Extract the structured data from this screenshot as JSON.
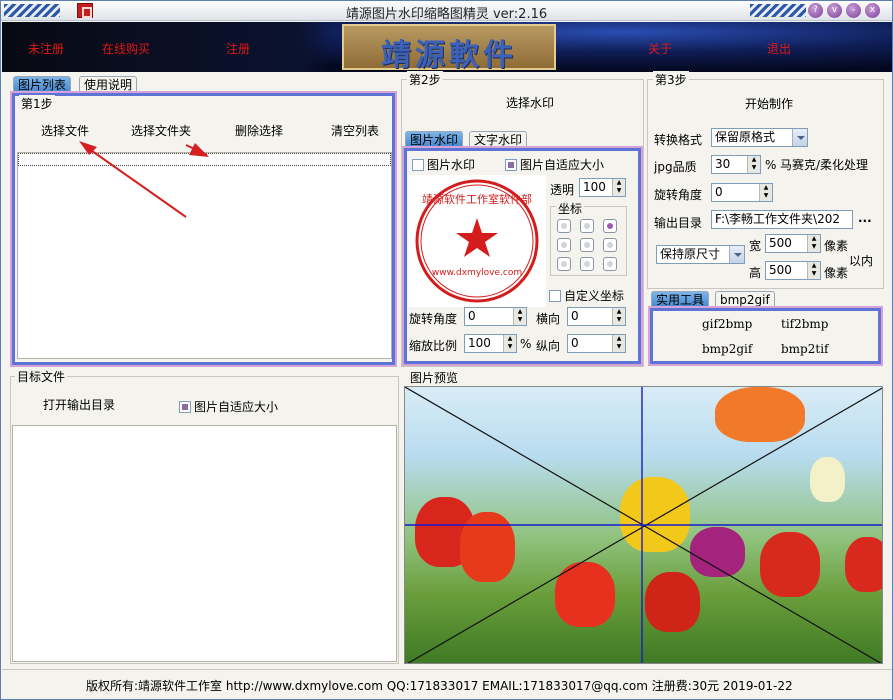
{
  "window": {
    "title": "靖源图片水印缩略图精灵 ver:2.16",
    "controls": [
      "?",
      "v",
      "-",
      "x"
    ]
  },
  "header": {
    "nav": [
      "未注册",
      "在线购买",
      "注册",
      "关于",
      "退出"
    ],
    "logo_text": "靖源軟件"
  },
  "left_tabs": [
    "图片列表",
    "使用说明"
  ],
  "step1": {
    "label": "第1步",
    "buttons": [
      "选择文件",
      "选择文件夹",
      "删除选择",
      "清空列表"
    ]
  },
  "target": {
    "label": "目标文件",
    "open_output": "打开输出目录",
    "fit_checkbox": "图片自适应大小",
    "fit_checked": true
  },
  "step2": {
    "label": "第2步",
    "select_watermark": "选择水印",
    "tabs": [
      "图片水印",
      "文字水印"
    ],
    "image_watermark_checkbox": "图片水印",
    "image_watermark_checked": false,
    "fit_checkbox": "图片自适应大小",
    "fit_checked": true,
    "transparency_label": "透明",
    "transparency_value": "100",
    "coords_label": "坐标",
    "custom_coords": "自定义坐标",
    "rotate_label": "旋转角度",
    "rotate_value": "0",
    "horizontal_label": "横向",
    "horizontal_value": "0",
    "scale_label": "缩放比例",
    "scale_value": "100",
    "percent": "%",
    "vertical_label": "纵向",
    "vertical_value": "0",
    "seal_text": "靖源软件工作室软件部",
    "seal_url": "www.dxmylove.com"
  },
  "step3": {
    "label": "第3步",
    "start": "开始制作",
    "format_label": "转换格式",
    "format_value": "保留原格式",
    "jpg_label": "jpg品质",
    "jpg_value": "30",
    "jpg_unit": "%",
    "mosaic": "马赛克/柔化处理",
    "rotate_label": "旋转角度",
    "rotate_value": "0",
    "output_label": "输出目录",
    "output_value": "F:\\李畅工作文件夹\\202",
    "browse": "...",
    "size_mode": "保持原尺寸",
    "width_label": "宽",
    "width_value": "500",
    "height_label": "高",
    "height_value": "500",
    "pixel_unit": "像素",
    "within": "以内"
  },
  "tools": {
    "tabs": [
      "实用工具",
      "bmp2gif"
    ],
    "buttons": [
      "gif2bmp",
      "tif2bmp",
      "bmp2gif",
      "bmp2tif"
    ]
  },
  "preview_label": "图片预览",
  "status": "版权所有:靖源软件工作室 http://www.dxmylove.com QQ:171833017 EMAIL:171833017@qq.com 注册费:30元 2019-01-22"
}
